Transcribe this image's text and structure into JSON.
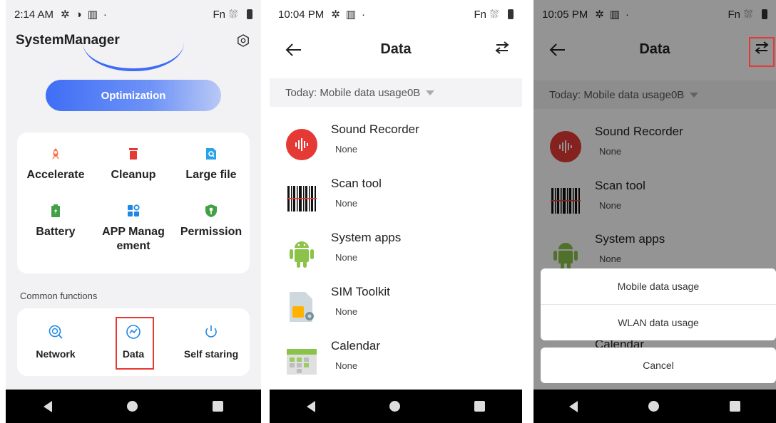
{
  "phone1": {
    "status": {
      "time": "2:14 AM",
      "fn": "Fn"
    },
    "title": "SystemManager",
    "optimize_label": "Optimization",
    "tools": [
      {
        "label": "Accelerate",
        "icon": "rocket-icon"
      },
      {
        "label": "Cleanup",
        "icon": "trash-icon"
      },
      {
        "label": "Large file",
        "icon": "large-file-icon"
      },
      {
        "label": "Battery",
        "icon": "battery-icon"
      },
      {
        "label": "APP Manag ement",
        "icon": "app-grid-icon"
      },
      {
        "label": "Permission",
        "icon": "shield-key-icon"
      }
    ],
    "common_functions_label": "Common functions",
    "functions": [
      {
        "label": "Network",
        "icon": "network-icon"
      },
      {
        "label": "Data",
        "icon": "data-icon"
      },
      {
        "label": "Self staring",
        "icon": "power-icon"
      }
    ]
  },
  "phone2": {
    "status": {
      "time": "10:04 PM",
      "fn": "Fn"
    },
    "title": "Data",
    "filter_label": "Today: Mobile data usage0B",
    "apps": [
      {
        "name": "Sound Recorder",
        "value": "None",
        "icon": "sound-recorder-icon"
      },
      {
        "name": "Scan tool",
        "value": "None",
        "icon": "barcode-icon"
      },
      {
        "name": "System apps",
        "value": "None",
        "icon": "android-icon"
      },
      {
        "name": "SIM Toolkit",
        "value": "None",
        "icon": "sim-card-icon"
      },
      {
        "name": "Calendar",
        "value": "None",
        "icon": "calendar-icon"
      }
    ]
  },
  "phone3": {
    "status": {
      "time": "10:05 PM",
      "fn": "Fn"
    },
    "title": "Data",
    "filter_label": "Today: Mobile data usage0B",
    "apps": [
      {
        "name": "Sound Recorder",
        "value": "None"
      },
      {
        "name": "Scan tool",
        "value": "None"
      },
      {
        "name": "System apps",
        "value": "None"
      },
      {
        "name": "Calendar"
      }
    ],
    "sheet_options": [
      "Mobile data usage",
      "WLAN data usage"
    ],
    "cancel_label": "Cancel"
  },
  "colors": {
    "accent": "#3d6bf5",
    "highlight": "#e53935",
    "android": "#8bc34a"
  }
}
